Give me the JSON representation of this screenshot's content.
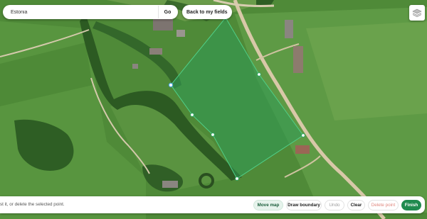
{
  "search": {
    "value": "Estonia",
    "go_label": "Go"
  },
  "back_label": "Back to my fields",
  "toolbar": {
    "hint": "st it, or delete the selected point.",
    "buttons": [
      {
        "label": "Move map",
        "state": "active"
      },
      {
        "label": "Draw boundary",
        "state": "normal"
      },
      {
        "label": "Undo",
        "state": "disabled"
      },
      {
        "label": "Clear",
        "state": "normal"
      },
      {
        "label": "Delete point",
        "state": "danger"
      },
      {
        "label": "Finish",
        "state": "primary"
      }
    ]
  },
  "colors": {
    "boundary": "#2fa866",
    "field_fill": "#2f9a55",
    "vertex_selected": "#4aa3d8",
    "primary": "#1f8a4f",
    "road": "#d8c8a8"
  },
  "icons": [
    "layers-icon"
  ]
}
